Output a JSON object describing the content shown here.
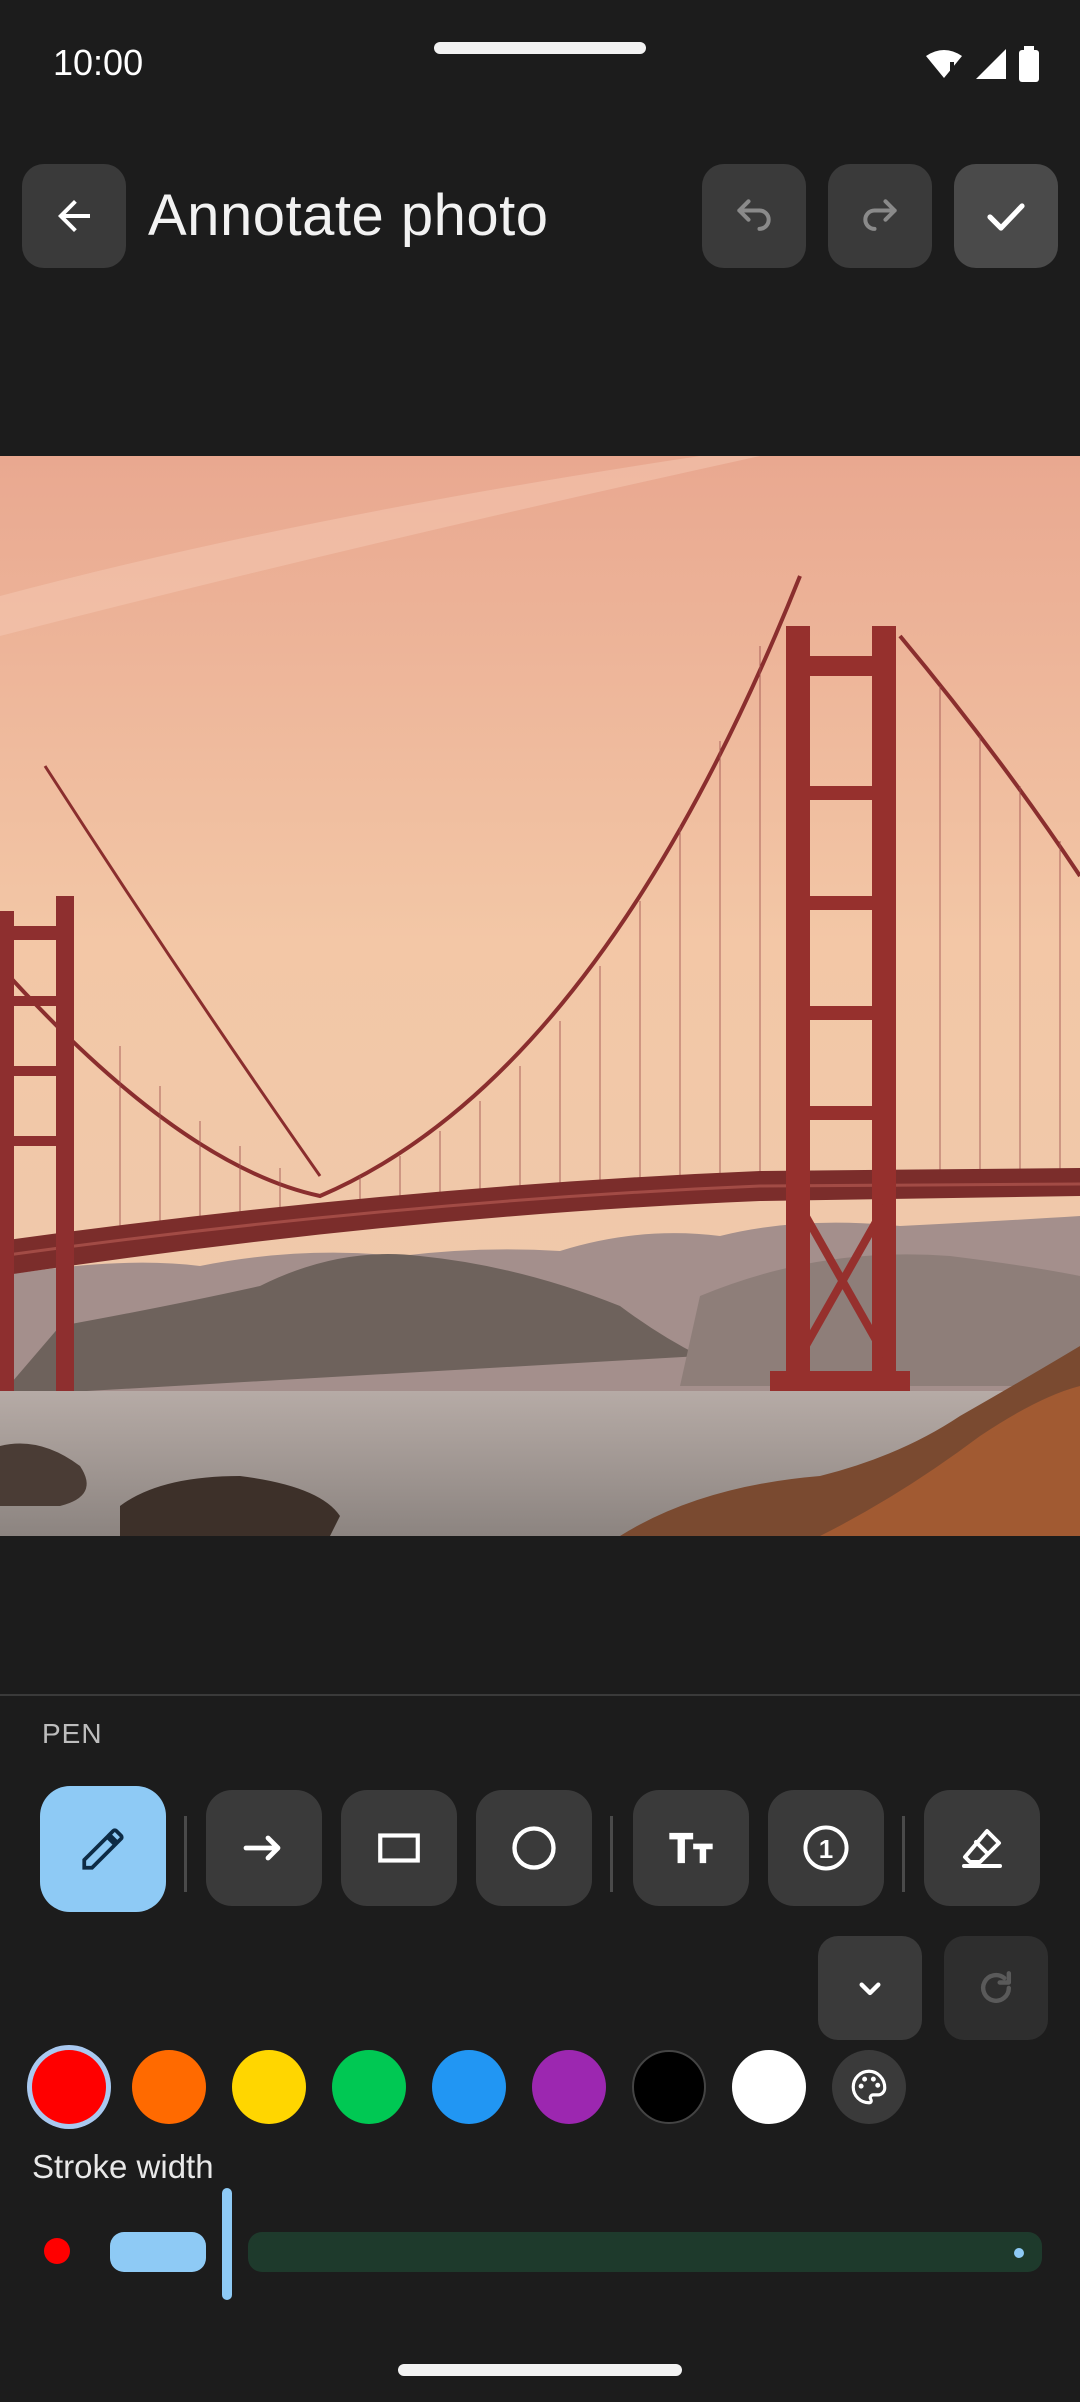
{
  "status_bar": {
    "time": "10:00"
  },
  "header": {
    "title": "Annotate photo"
  },
  "photo": {
    "subject": "Golden Gate Bridge at sunset"
  },
  "panel": {
    "mode_label": "PEN",
    "tools": [
      {
        "name": "pen",
        "icon": "pencil-icon",
        "active": true
      },
      {
        "name": "arrow",
        "icon": "arrow-right-icon",
        "active": false
      },
      {
        "name": "rectangle",
        "icon": "rectangle-icon",
        "active": false
      },
      {
        "name": "ellipse",
        "icon": "circle-icon",
        "active": false
      },
      {
        "name": "text",
        "icon": "text-icon",
        "active": false
      },
      {
        "name": "counter",
        "icon": "numbered-circle-icon",
        "counter_value": "1",
        "active": false
      },
      {
        "name": "eraser",
        "icon": "eraser-icon",
        "active": false
      }
    ],
    "colors": [
      "#ff0000",
      "#ff6a00",
      "#ffd600",
      "#00c853",
      "#2196f3",
      "#9c27b0",
      "#000000",
      "#ffffff"
    ],
    "selected_color": "#ff0000",
    "stroke_label": "Stroke width",
    "stroke_value_fraction": 0.15
  }
}
